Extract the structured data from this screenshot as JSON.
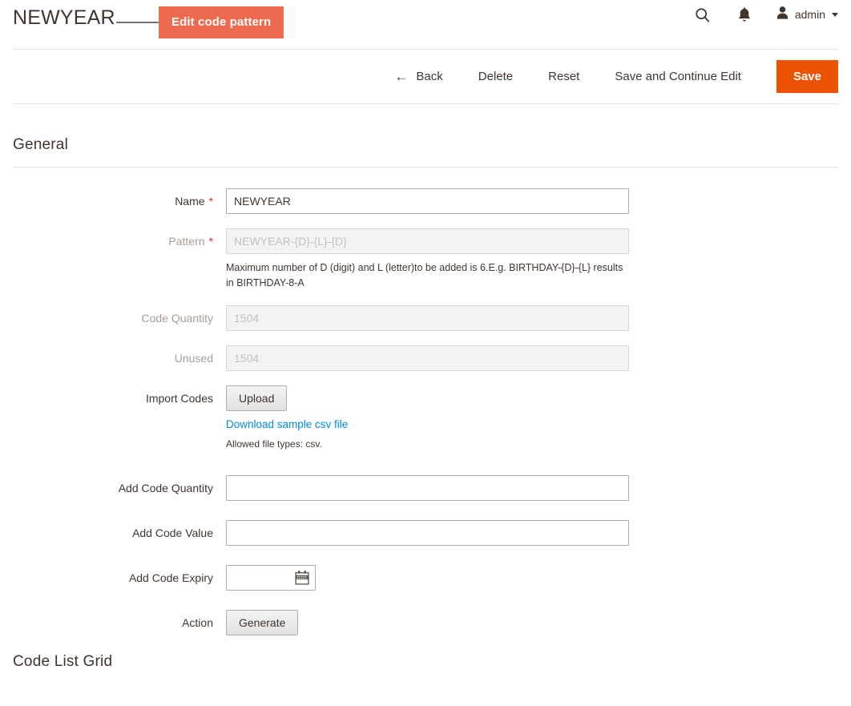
{
  "header": {
    "title": "NEWYEAR",
    "search_icon": "search-icon",
    "notifications_icon": "bell-icon",
    "user_icon": "user-avatar-icon",
    "user_name": "admin"
  },
  "callout": {
    "label": "Edit code pattern",
    "color": "#ee6a4e"
  },
  "actions": {
    "back_label": "Back",
    "back_icon": "arrow-left-icon",
    "delete_label": "Delete",
    "reset_label": "Reset",
    "save_continue_label": "Save and Continue Edit",
    "save_label": "Save",
    "save_color": "#eb5202"
  },
  "general": {
    "section_title": "General",
    "fields": {
      "name": {
        "label": "Name",
        "required": "*",
        "value": "NEWYEAR",
        "placeholder": ""
      },
      "pattern": {
        "label": "Pattern",
        "required": "*",
        "value": "",
        "placeholder": "NEWYEAR-{D}-{L}-{D}",
        "note": "Maximum number of D (digit) and L (letter)to be added is 6.E.g. BIRTHDAY-{D}-{L} results in BIRTHDAY-8-A"
      },
      "code_quantity": {
        "label": "Code Quantity",
        "value": "",
        "placeholder": "1504"
      },
      "unused": {
        "label": "Unused",
        "value": "",
        "placeholder": "1504"
      },
      "import_codes": {
        "label": "Import Codes",
        "upload_label": "Upload",
        "sample_link": "Download sample csv file",
        "allowed_note": "Allowed file types: csv."
      },
      "add_code_quantity": {
        "label": "Add Code Quantity",
        "value": "",
        "placeholder": ""
      },
      "add_code_value": {
        "label": "Add Code Value",
        "value": "",
        "placeholder": ""
      },
      "add_code_expiry": {
        "label": "Add Code Expiry",
        "value": "",
        "placeholder": "",
        "calendar_icon": "calendar-icon"
      },
      "action": {
        "label": "Action",
        "generate_label": "Generate"
      }
    }
  },
  "code_list_grid": {
    "section_title": "Code List Grid"
  }
}
